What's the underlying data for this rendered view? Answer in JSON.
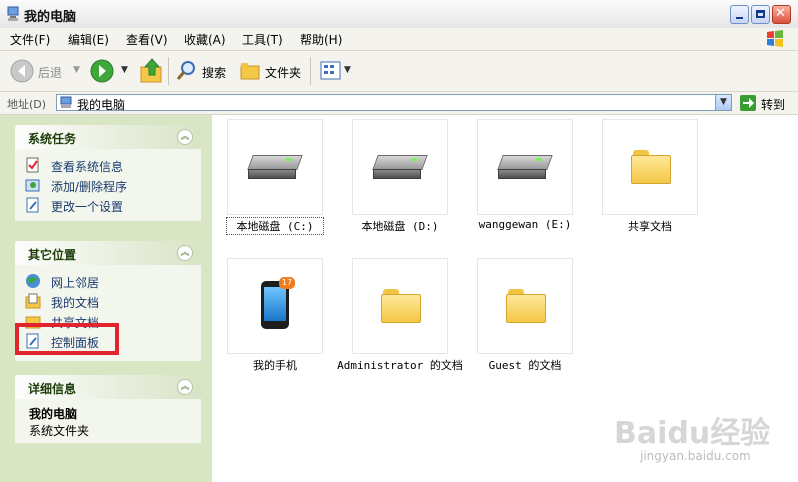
{
  "window": {
    "title": "我的电脑"
  },
  "menu": [
    "文件(F)",
    "编辑(E)",
    "查看(V)",
    "收藏(A)",
    "工具(T)",
    "帮助(H)"
  ],
  "toolbar": {
    "back_label": "后退",
    "search_label": "搜索",
    "folders_label": "文件夹"
  },
  "address": {
    "label": "地址(D)",
    "value": "我的电脑",
    "go_label": "转到"
  },
  "left_panels": [
    {
      "title": "系统任务",
      "items": [
        "查看系统信息",
        "添加/删除程序",
        "更改一个设置"
      ]
    },
    {
      "title": "其它位置",
      "items": [
        "网上邻居",
        "我的文档",
        "共享文档",
        "控制面板"
      ]
    },
    {
      "title": "详细信息",
      "detail_title": "我的电脑",
      "detail_sub": "系统文件夹"
    }
  ],
  "items": [
    {
      "label": "本地磁盘 (C:)",
      "icon": "drive-icon"
    },
    {
      "label": "本地磁盘 (D:)",
      "icon": "drive-icon"
    },
    {
      "label": "wanggewan (E:)",
      "icon": "drive-icon"
    },
    {
      "label": "共享文档",
      "icon": "folder-icon"
    },
    {
      "label": "我的手机",
      "icon": "phone-icon",
      "badge": "17"
    },
    {
      "label": "Administrator 的文档",
      "icon": "folder-icon"
    },
    {
      "label": "Guest 的文档",
      "icon": "folder-icon"
    }
  ],
  "watermark": {
    "brand": "Baidu经验",
    "url": "jingyan.baidu.com"
  },
  "colors": {
    "highlight": "#e0252f",
    "left_pane": "#d9e6c4",
    "link": "#1a3a6e"
  }
}
